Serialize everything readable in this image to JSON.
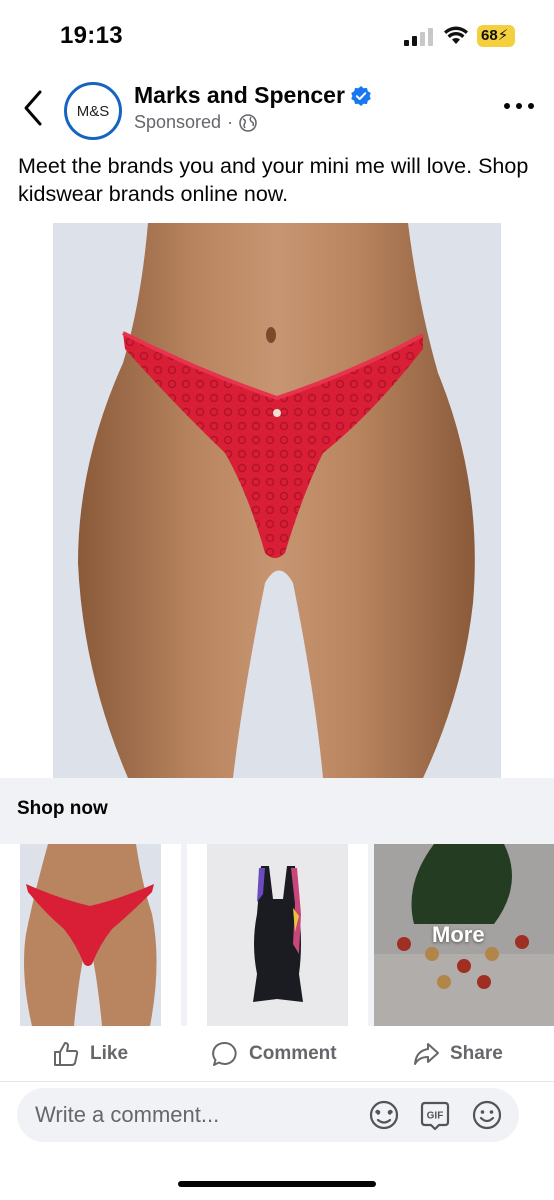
{
  "status_bar": {
    "time": "19:13",
    "battery": "68",
    "icons": [
      "cellular-signal-icon",
      "wifi-icon",
      "battery-charging-icon"
    ]
  },
  "header": {
    "back_icon": "chevron-left-icon",
    "avatar_text": "M&S",
    "page_name": "Marks and Spencer",
    "verified_icon": "verified-badge-icon",
    "sponsored": "Sponsored",
    "separator": "·",
    "audience_icon": "globe-icon",
    "more_icon": "more-horizontal-icon"
  },
  "post": {
    "caption": "Meet the brands you and your mini me will love. Shop kidswear brands online now."
  },
  "shop": {
    "label": "Shop now"
  },
  "carousel": {
    "items": [
      {
        "image": "red-lace-underwear-photo"
      },
      {
        "image": "black-swimsuit-photo"
      },
      {
        "image": "christmas-figurines-photo",
        "overlay": "More"
      }
    ]
  },
  "actions": {
    "like": "Like",
    "comment": "Comment",
    "share": "Share"
  },
  "comment_bar": {
    "placeholder": "Write a comment...",
    "icons": [
      "avatar-sticker-icon",
      "gif-icon",
      "emoji-icon"
    ]
  },
  "colors": {
    "verified_blue": "#1877f2",
    "avatar_ring": "#1565c0",
    "muted_text": "#65676b",
    "surface_gray": "#f0f2f5",
    "battery_yellow": "#f4d03f"
  }
}
